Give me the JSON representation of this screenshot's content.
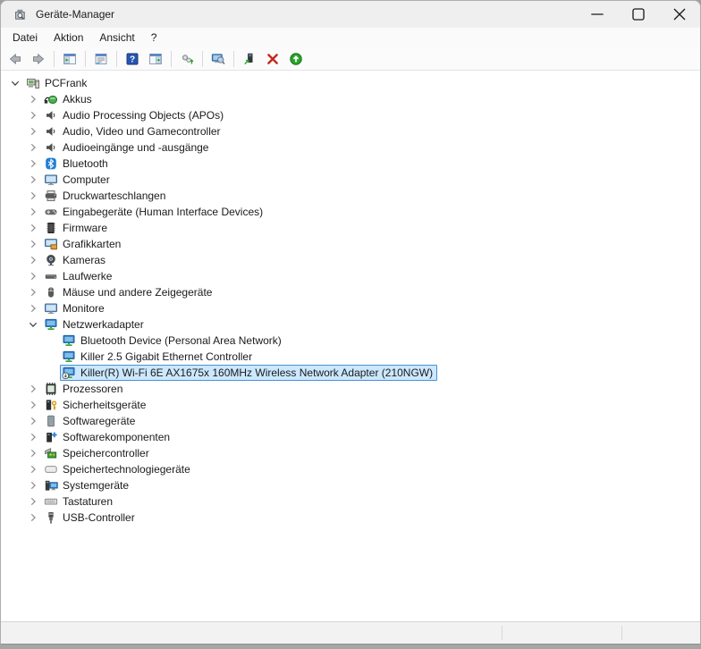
{
  "window": {
    "title": "Geräte-Manager",
    "app_icon": "device-manager-icon"
  },
  "colors": {
    "selection_bg": "#cce8ff",
    "selection_border": "#4a90d6"
  },
  "menubar": {
    "items": [
      {
        "name": "datei",
        "label": "Datei"
      },
      {
        "name": "aktion",
        "label": "Aktion"
      },
      {
        "name": "ansicht",
        "label": "Ansicht"
      },
      {
        "name": "hilfe",
        "label": "?"
      }
    ]
  },
  "toolbar": {
    "items": [
      {
        "type": "button",
        "name": "back-button",
        "icon": "back-arrow-icon"
      },
      {
        "type": "button",
        "name": "forward-button",
        "icon": "forward-arrow-icon"
      },
      {
        "type": "separator"
      },
      {
        "type": "button",
        "name": "show-console-tree-button",
        "icon": "console-tree-icon"
      },
      {
        "type": "separator"
      },
      {
        "type": "button",
        "name": "properties-button",
        "icon": "properties-window-icon"
      },
      {
        "type": "separator"
      },
      {
        "type": "button",
        "name": "help-button",
        "icon": "help-icon"
      },
      {
        "type": "button",
        "name": "action-pane-button",
        "icon": "action-pane-icon"
      },
      {
        "type": "separator"
      },
      {
        "type": "button",
        "name": "scan-hardware-button",
        "icon": "gears-refresh-icon"
      },
      {
        "type": "separator"
      },
      {
        "type": "button",
        "name": "search-computer-button",
        "icon": "computer-search-icon"
      },
      {
        "type": "separator"
      },
      {
        "type": "button",
        "name": "update-driver-button",
        "icon": "device-update-icon"
      },
      {
        "type": "button",
        "name": "uninstall-device-button",
        "icon": "uninstall-x-icon"
      },
      {
        "type": "button",
        "name": "enable-device-button",
        "icon": "enable-device-icon"
      }
    ]
  },
  "tree": {
    "items": [
      {
        "label": "PCFrank",
        "icon": "computer-icon",
        "level": 0,
        "chevron": "expanded"
      },
      {
        "label": "Akkus",
        "icon": "battery-icon",
        "level": 1,
        "chevron": "collapsed"
      },
      {
        "label": "Audio Processing Objects (APOs)",
        "icon": "speaker-icon",
        "level": 1,
        "chevron": "collapsed"
      },
      {
        "label": "Audio, Video und Gamecontroller",
        "icon": "speaker-icon",
        "level": 1,
        "chevron": "collapsed"
      },
      {
        "label": "Audioeingänge und -ausgänge",
        "icon": "speaker-icon",
        "level": 1,
        "chevron": "collapsed"
      },
      {
        "label": "Bluetooth",
        "icon": "bluetooth-icon",
        "level": 1,
        "chevron": "collapsed"
      },
      {
        "label": "Computer",
        "icon": "monitor-icon",
        "level": 1,
        "chevron": "collapsed"
      },
      {
        "label": "Druckwarteschlangen",
        "icon": "printer-icon",
        "level": 1,
        "chevron": "collapsed"
      },
      {
        "label": "Eingabegeräte (Human Interface Devices)",
        "icon": "gamepad-icon",
        "level": 1,
        "chevron": "collapsed"
      },
      {
        "label": "Firmware",
        "icon": "chip-icon",
        "level": 1,
        "chevron": "collapsed"
      },
      {
        "label": "Grafikkarten",
        "icon": "gpu-icon",
        "level": 1,
        "chevron": "collapsed"
      },
      {
        "label": "Kameras",
        "icon": "camera-icon",
        "level": 1,
        "chevron": "collapsed"
      },
      {
        "label": "Laufwerke",
        "icon": "drive-icon",
        "level": 1,
        "chevron": "collapsed"
      },
      {
        "label": "Mäuse und andere Zeigegeräte",
        "icon": "mouse-icon",
        "level": 1,
        "chevron": "collapsed"
      },
      {
        "label": "Monitore",
        "icon": "monitor-icon",
        "level": 1,
        "chevron": "collapsed"
      },
      {
        "label": "Netzwerkadapter",
        "icon": "network-adapter-icon",
        "level": 1,
        "chevron": "expanded"
      },
      {
        "label": "Bluetooth Device (Personal Area Network)",
        "icon": "network-adapter-icon",
        "level": 2,
        "chevron": "none"
      },
      {
        "label": "Killer 2.5 Gigabit Ethernet Controller",
        "icon": "network-adapter-icon",
        "level": 2,
        "chevron": "none"
      },
      {
        "label": "Killer(R) Wi-Fi 6E AX1675x 160MHz Wireless Network Adapter (210NGW)",
        "icon": "network-adapter-disabled-icon",
        "level": 2,
        "chevron": "none",
        "selected": true
      },
      {
        "label": "Prozessoren",
        "icon": "cpu-icon",
        "level": 1,
        "chevron": "collapsed"
      },
      {
        "label": "Sicherheitsgeräte",
        "icon": "security-device-icon",
        "level": 1,
        "chevron": "collapsed"
      },
      {
        "label": "Softwaregeräte",
        "icon": "software-device-icon",
        "level": 1,
        "chevron": "collapsed"
      },
      {
        "label": "Softwarekomponenten",
        "icon": "software-component-icon",
        "level": 1,
        "chevron": "collapsed"
      },
      {
        "label": "Speichercontroller",
        "icon": "storage-controller-icon",
        "level": 1,
        "chevron": "collapsed"
      },
      {
        "label": "Speichertechnologiegeräte",
        "icon": "storage-tech-icon",
        "level": 1,
        "chevron": "collapsed"
      },
      {
        "label": "Systemgeräte",
        "icon": "system-device-icon",
        "level": 1,
        "chevron": "collapsed"
      },
      {
        "label": "Tastaturen",
        "icon": "keyboard-icon",
        "level": 1,
        "chevron": "collapsed"
      },
      {
        "label": "USB-Controller",
        "icon": "usb-icon",
        "level": 1,
        "chevron": "collapsed"
      }
    ]
  }
}
